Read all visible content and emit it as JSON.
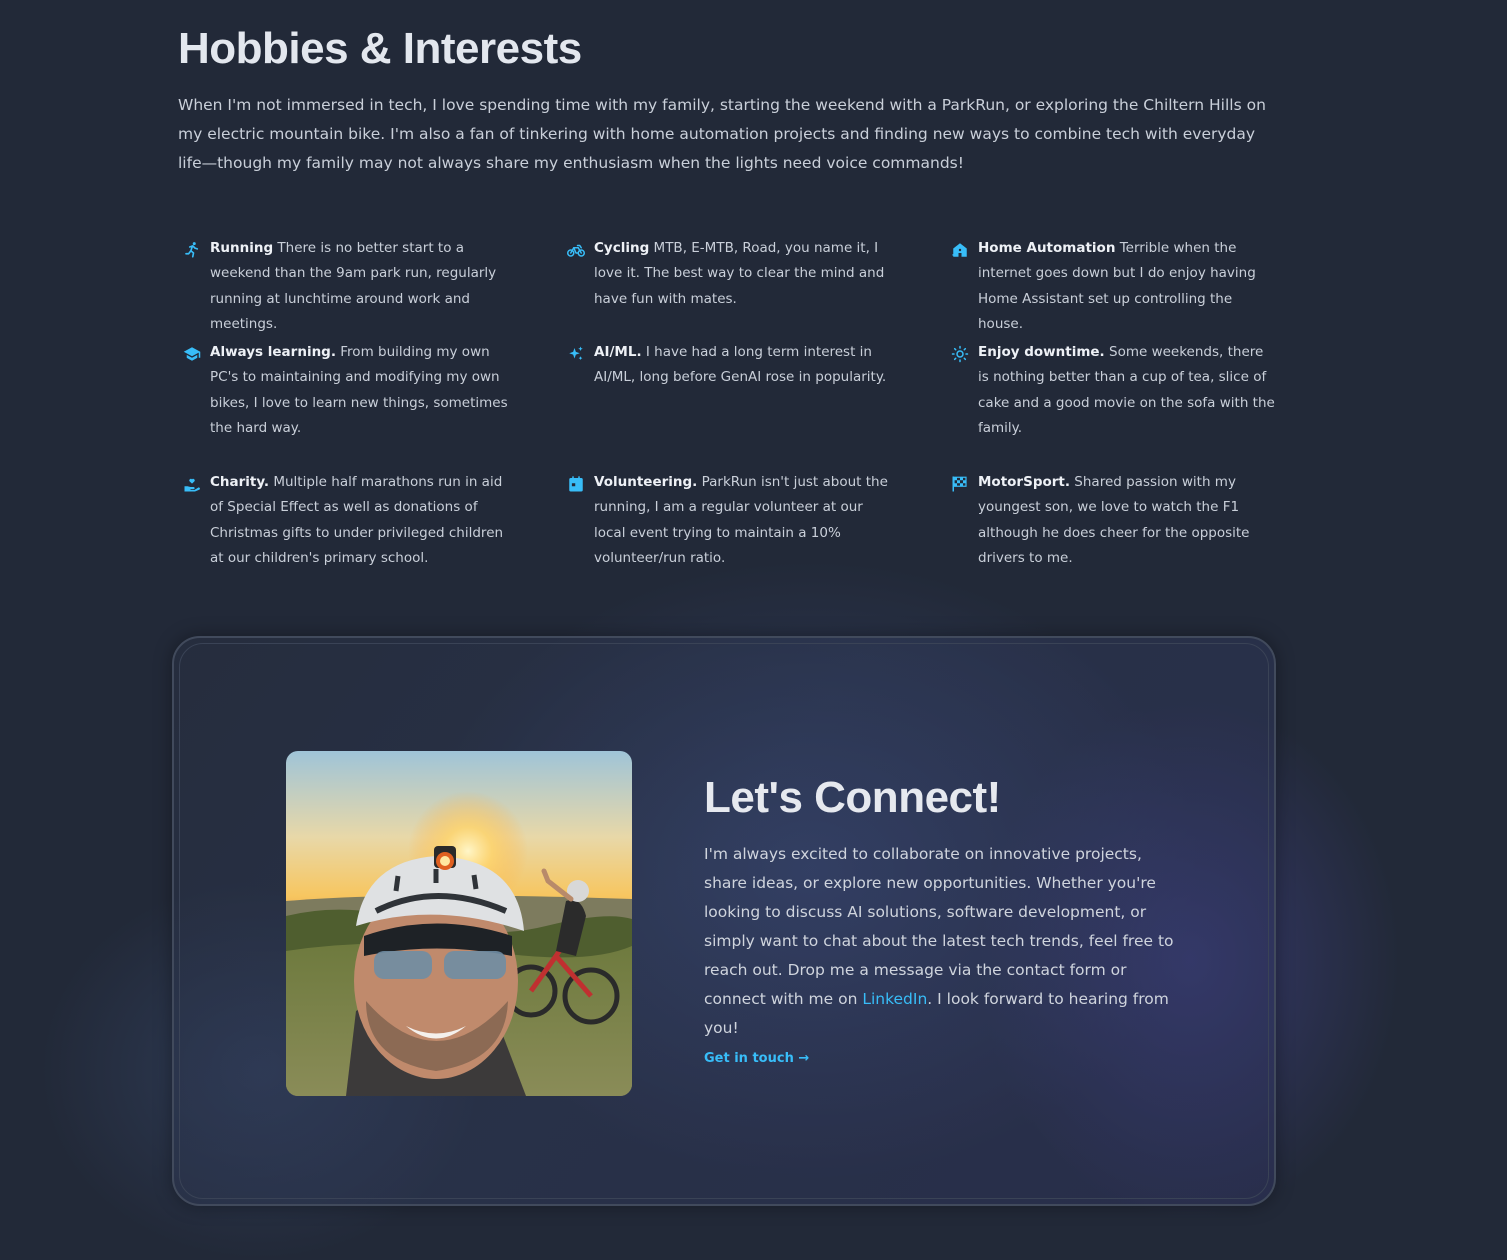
{
  "hobbies": {
    "title": "Hobbies & Interests",
    "intro": "When I'm not immersed in tech, I love spending time with my family, starting the weekend with a ParkRun, or exploring the Chiltern Hills on my electric mountain bike. I'm also a fan of tinkering with home automation projects and finding new ways to combine tech with everyday life—though my family may not always share my enthusiasm when the lights need voice commands!",
    "items": [
      {
        "icon": "running-icon",
        "title": "Running",
        "text": " There is no better start to a weekend than the 9am park run, regularly running at lunchtime around work and meetings."
      },
      {
        "icon": "bicycle-icon",
        "title": "Cycling",
        "text": " MTB, E-MTB, Road, you name it, I love it. The best way to clear the mind and have fun with mates."
      },
      {
        "icon": "home-wifi-icon",
        "title": "Home Automation",
        "text": " Terrible when the internet goes down but I do enjoy having Home Assistant set up controlling the house."
      },
      {
        "icon": "graduation-cap-icon",
        "title": "Always learning.",
        "text": " From building my own PC's to maintaining and modifying my own bikes, I love to learn new things, sometimes the hard way."
      },
      {
        "icon": "sparkles-icon",
        "title": "AI/ML.",
        "text": " I have had a long term interest in AI/ML, long before GenAI rose in popularity."
      },
      {
        "icon": "sun-icon",
        "title": "Enjoy downtime.",
        "text": " Some weekends, there is nothing better than a cup of tea, slice of cake and a good movie on the sofa with the family."
      },
      {
        "icon": "hand-heart-icon",
        "title": "Charity.",
        "text": " Multiple half marathons run in aid of Special Effect as well as donations of Christmas gifts to under privileged children at our children's primary school."
      },
      {
        "icon": "calendar-icon",
        "title": "Volunteering.",
        "text": " ParkRun isn't just about the running, I am a regular volunteer at our local event trying to maintain a 10% volunteer/run ratio."
      },
      {
        "icon": "checkered-flag-icon",
        "title": "MotorSport.",
        "text": " Shared passion with my youngest son, we love to watch the F1 although he does cheer for the opposite drivers to me."
      }
    ]
  },
  "connect": {
    "title": "Let's Connect!",
    "text_before_link": "I'm always excited to collaborate on innovative projects, share ideas, or explore new opportunities. Whether you're looking to discuss AI solutions, software development, or simply want to chat about the latest tech trends, feel free to reach out. Drop me a message via the contact form or connect with me on ",
    "link_label": "LinkedIn",
    "text_after_link": ". I look forward to hearing from you!",
    "cta_label": "Get in touch →"
  },
  "colors": {
    "background": "#222938",
    "accent": "#38bdf8",
    "heading": "#e3e7ee",
    "body_text": "#c9cfd9"
  }
}
